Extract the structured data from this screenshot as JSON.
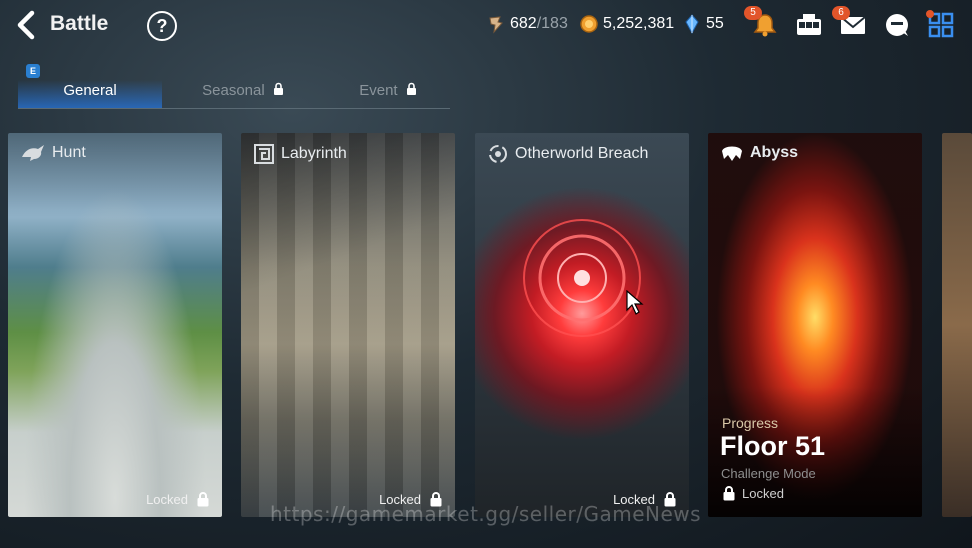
{
  "header": {
    "title": "Battle",
    "help_glyph": "?",
    "resources": [
      {
        "icon": "stamina-icon",
        "value": "682",
        "max": "/183"
      },
      {
        "icon": "gold-icon",
        "value": "5,252,381"
      },
      {
        "icon": "crystal-icon",
        "value": "55"
      }
    ],
    "notifications": {
      "bell_badge": "5",
      "mail_badge": "6"
    }
  },
  "tabs": [
    {
      "label": "General",
      "active": true,
      "badge": "E"
    },
    {
      "label": "Seasonal",
      "locked": true
    },
    {
      "label": "Event",
      "locked": true
    }
  ],
  "cards": [
    {
      "name": "Hunt",
      "icon": "dragon-icon",
      "status": "Locked"
    },
    {
      "name": "Labyrinth",
      "icon": "maze-icon",
      "status": "Locked"
    },
    {
      "name": "Otherworld Breach",
      "icon": "portal-icon",
      "status": "Locked"
    },
    {
      "name": "Abyss",
      "icon": "abyss-icon",
      "progress_label": "Progress",
      "progress_value": "Floor 51",
      "mode": "Challenge Mode",
      "status": "Locked"
    }
  ],
  "watermark": "https://gamemarket.gg/seller/GameNews",
  "colors": {
    "accent": "#2a7fd0",
    "badge": "#e2552a",
    "background": "#1e2a33"
  }
}
